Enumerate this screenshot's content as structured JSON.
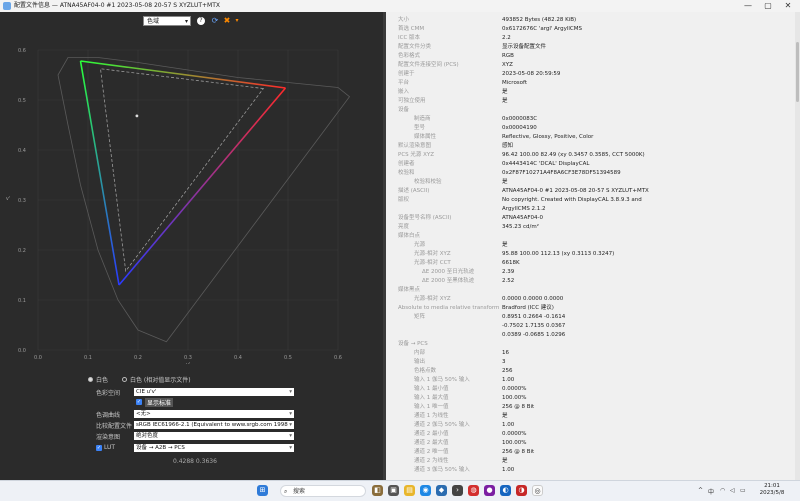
{
  "window": {
    "title": "配置文件信息 — ATNA45AF04-0 #1 2023-05-08 20-57 S XYZLUT+MTX",
    "minimize": "—",
    "maximize": "▢",
    "close": "✕"
  },
  "toolbar": {
    "view_select": "色域",
    "help_icon": "?",
    "close_icon": "✖"
  },
  "plot": {
    "x_ticks": [
      "0.0",
      "0.1",
      "0.2",
      "0.3",
      "0.4",
      "0.5",
      "0.6"
    ],
    "y_ticks": [
      "0.0",
      "0.1",
      "0.2",
      "0.3",
      "0.4",
      "0.5",
      "0.6"
    ],
    "x_axis_label": "u'",
    "y_axis_label": "v'"
  },
  "controls": {
    "white_radio": "白色",
    "white_relative_radio": "白色 (相对值显示文件)",
    "color_space_label": "色彩空间",
    "color_space_value": "CIE u'v'",
    "show_spectral_label": "显示标准",
    "compare_label": "色调曲线",
    "compare_value": "<无>",
    "compare_profile_label": "比较配置文件",
    "compare_profile_value": "sRGB IEC61966-2.1 (Equivalent to www.srgb.com 1998",
    "rendering_label": "渲染意图",
    "rendering_value": "绝对色度",
    "lut_label": "LUT",
    "lut_value": "设备 → A2B → PCS",
    "coords": "0.4288 0.3636"
  },
  "info_rows": [
    {
      "label": "大小",
      "value": "493852 Bytes (482.28 KiB)",
      "indent": 0
    },
    {
      "label": "首选 CMM",
      "value": "0x6172676C 'argl' ArgyllCMS",
      "indent": 0
    },
    {
      "label": "ICC 版本",
      "value": "2.2",
      "indent": 0
    },
    {
      "label": "配置文件分类",
      "value": "显示设备配置文件",
      "indent": 0
    },
    {
      "label": "色彩格式",
      "value": "RGB",
      "indent": 0
    },
    {
      "label": "配置文件连接空间 (PCS)",
      "value": "XYZ",
      "indent": 0
    },
    {
      "label": "创建于",
      "value": "2023-05-08 20:59:59",
      "indent": 0
    },
    {
      "label": "平台",
      "value": "Microsoft",
      "indent": 0
    },
    {
      "label": "嵌入",
      "value": "是",
      "indent": 0
    },
    {
      "label": "可独立使用",
      "value": "是",
      "indent": 0
    },
    {
      "label": "设备",
      "value": "",
      "indent": 0
    },
    {
      "label": "制造商",
      "value": "0x0000083C",
      "indent": 1
    },
    {
      "label": "型号",
      "value": "0x00004190",
      "indent": 1
    },
    {
      "label": "媒体属性",
      "value": "Reflective, Glossy, Positive, Color",
      "indent": 1
    },
    {
      "label": "默认渲染意图",
      "value": "感知",
      "indent": 0
    },
    {
      "label": "PCS 光源 XYZ",
      "value": "96.42 100.00 82.49 (xy 0.3457 0.3585, CCT 5000K)",
      "indent": 0
    },
    {
      "label": "创建者",
      "value": "0x4443414C 'DCAL' DisplayCAL",
      "indent": 0
    },
    {
      "label": "校验和",
      "value": "0x2F87F10271A4F8A6CF3E78DF51394589",
      "indent": 0
    },
    {
      "label": "校验和校验",
      "value": "是",
      "indent": 1
    },
    {
      "label": "描述 (ASCII)",
      "value": "ATNA45AF04-0 #1 2023-05-08 20-57 S XYZLUT+MTX",
      "indent": 0
    },
    {
      "label": "版权",
      "value": "No copyright. Created with DisplayCAL 3.8.9.3 and",
      "indent": 0
    },
    {
      "label": "",
      "value": "ArgyllCMS 2.1.2",
      "indent": 0
    },
    {
      "label": "设备型号名称 (ASCII)",
      "value": "ATNA45AF04-0",
      "indent": 0
    },
    {
      "label": "亮度",
      "value": "345.23 cd/m²",
      "indent": 0
    },
    {
      "label": "媒体白点",
      "value": "",
      "indent": 0
    },
    {
      "label": "光源",
      "value": "是",
      "indent": 1
    },
    {
      "label": "光源-相对 XYZ",
      "value": "95.88 100.00 112.13 (xy 0.3113 0.3247)",
      "indent": 1
    },
    {
      "label": "光源-相对 CCT",
      "value": "6618K",
      "indent": 1
    },
    {
      "label": "ΔE 2000 至日光轨迹",
      "value": "2.39",
      "indent": 2
    },
    {
      "label": "ΔE 2000 至黑体轨迹",
      "value": "2.52",
      "indent": 2
    },
    {
      "label": "媒体黑点",
      "value": "",
      "indent": 0
    },
    {
      "label": "光源-相对 XYZ",
      "value": "0.0000 0.0000 0.0000",
      "indent": 1
    },
    {
      "label": "Absolute to media relative transform",
      "value": "Bradford (ICC 建议)",
      "indent": 0
    },
    {
      "label": "矩阵",
      "value": "0.8951 0.2664 -0.1614",
      "indent": 1
    },
    {
      "label": "",
      "value": "-0.7502 1.7135 0.0367",
      "indent": 1
    },
    {
      "label": "",
      "value": "0.0389 -0.0685 1.0296",
      "indent": 1
    },
    {
      "label": "设备 → PCS",
      "value": "",
      "indent": 0
    },
    {
      "label": "内部",
      "value": "16",
      "indent": 1
    },
    {
      "label": "输出",
      "value": "3",
      "indent": 1
    },
    {
      "label": "色格点数",
      "value": "256",
      "indent": 1
    },
    {
      "label": "输入 1 伽马 50% 输入",
      "value": "1.00",
      "indent": 1
    },
    {
      "label": "输入 1 最小值",
      "value": "0.0000%",
      "indent": 1
    },
    {
      "label": "输入 1 最大值",
      "value": "100.00%",
      "indent": 1
    },
    {
      "label": "输入 1 唯一值",
      "value": "256 @ 8 Bit",
      "indent": 1
    },
    {
      "label": "通道 1 为线性",
      "value": "是",
      "indent": 1
    },
    {
      "label": "通道 2 伽马 50% 输入",
      "value": "1.00",
      "indent": 1
    },
    {
      "label": "通道 2 最小值",
      "value": "0.0000%",
      "indent": 1
    },
    {
      "label": "通道 2 最大值",
      "value": "100.00%",
      "indent": 1
    },
    {
      "label": "通道 2 唯一值",
      "value": "256 @ 8 Bit",
      "indent": 1
    },
    {
      "label": "通道 2 为线性",
      "value": "是",
      "indent": 1
    },
    {
      "label": "通道 3 伽马 50% 输入",
      "value": "1.00",
      "indent": 1
    }
  ],
  "taskbar": {
    "search_placeholder": "搜索",
    "time": "21:01",
    "date": "2023/5/8",
    "lang": "中"
  }
}
